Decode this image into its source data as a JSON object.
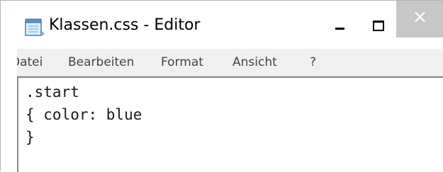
{
  "window": {
    "title": "Klassen.css - Editor"
  },
  "title_buttons": {
    "minimize": "minimize",
    "maximize": "maximize",
    "close_glyph": "×"
  },
  "menu": {
    "items": [
      "Datei",
      "Bearbeiten",
      "Format",
      "Ansicht",
      "?"
    ]
  },
  "editor": {
    "lines": [
      ".start",
      "{ color: blue",
      "}"
    ]
  },
  "colors": {
    "close_button_bg": "#c7c7c7",
    "menubar_bg": "#f0f0f0",
    "text": "#000000"
  },
  "icons": {
    "app_icon": "notepad-icon"
  }
}
